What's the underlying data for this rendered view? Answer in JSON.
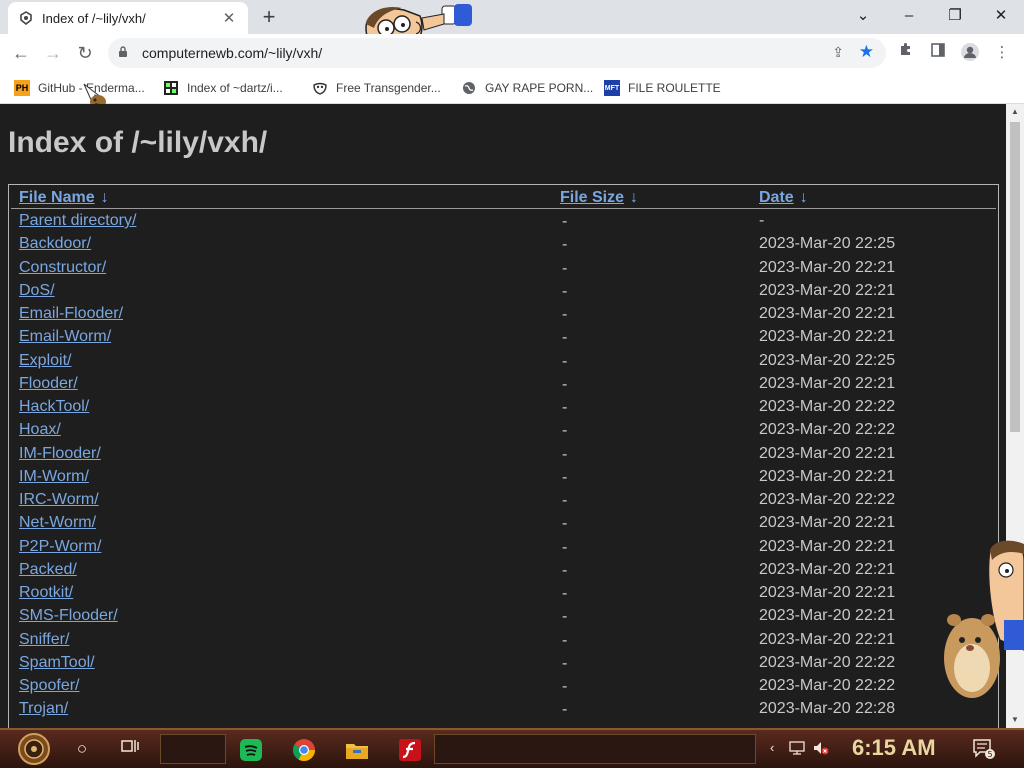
{
  "browser": {
    "tab": {
      "title": "Index of /~lily/vxh/",
      "favicon": "site-icon"
    },
    "new_tab_label": "+",
    "window_controls": {
      "tabsearch": "⌄",
      "minimize": "–",
      "restore": "❐",
      "close": "✕"
    },
    "url": "computernewb.com/~lily/vxh/",
    "bookmarks": [
      {
        "label": "GitHub - Enderma...",
        "icon": "PH"
      },
      {
        "label": "Index of ~dartz/i...",
        "icon": "grid-icon"
      },
      {
        "label": "Free Transgender...",
        "icon": "mask-icon"
      },
      {
        "label": "GAY RAPE PORN...",
        "icon": "globe-icon"
      },
      {
        "label": "FILE ROULETTE",
        "icon": "MFT"
      }
    ]
  },
  "page": {
    "heading": "Index of /~lily/vxh/",
    "columns": {
      "name": "File Name",
      "size": "File Size",
      "date": "Date",
      "sort_arrow": "↓"
    },
    "rows": [
      {
        "name": "Parent directory/",
        "size": "-",
        "date": "-"
      },
      {
        "name": "Backdoor/",
        "size": "-",
        "date": "2023-Mar-20 22:25"
      },
      {
        "name": "Constructor/",
        "size": "-",
        "date": "2023-Mar-20 22:21"
      },
      {
        "name": "DoS/",
        "size": "-",
        "date": "2023-Mar-20 22:21"
      },
      {
        "name": "Email-Flooder/",
        "size": "-",
        "date": "2023-Mar-20 22:21"
      },
      {
        "name": "Email-Worm/",
        "size": "-",
        "date": "2023-Mar-20 22:21"
      },
      {
        "name": "Exploit/",
        "size": "-",
        "date": "2023-Mar-20 22:25"
      },
      {
        "name": "Flooder/",
        "size": "-",
        "date": "2023-Mar-20 22:21"
      },
      {
        "name": "HackTool/",
        "size": "-",
        "date": "2023-Mar-20 22:22"
      },
      {
        "name": "Hoax/",
        "size": "-",
        "date": "2023-Mar-20 22:22"
      },
      {
        "name": "IM-Flooder/",
        "size": "-",
        "date": "2023-Mar-20 22:21"
      },
      {
        "name": "IM-Worm/",
        "size": "-",
        "date": "2023-Mar-20 22:21"
      },
      {
        "name": "IRC-Worm/",
        "size": "-",
        "date": "2023-Mar-20 22:22"
      },
      {
        "name": "Net-Worm/",
        "size": "-",
        "date": "2023-Mar-20 22:21"
      },
      {
        "name": "P2P-Worm/",
        "size": "-",
        "date": "2023-Mar-20 22:21"
      },
      {
        "name": "Packed/",
        "size": "-",
        "date": "2023-Mar-20 22:21"
      },
      {
        "name": "Rootkit/",
        "size": "-",
        "date": "2023-Mar-20 22:21"
      },
      {
        "name": "SMS-Flooder/",
        "size": "-",
        "date": "2023-Mar-20 22:21"
      },
      {
        "name": "Sniffer/",
        "size": "-",
        "date": "2023-Mar-20 22:21"
      },
      {
        "name": "SpamTool/",
        "size": "-",
        "date": "2023-Mar-20 22:22"
      },
      {
        "name": "Spoofer/",
        "size": "-",
        "date": "2023-Mar-20 22:22"
      },
      {
        "name": "Trojan/",
        "size": "-",
        "date": "2023-Mar-20 22:28"
      }
    ]
  },
  "taskbar": {
    "clock": "6:15 AM",
    "notification_count": "5",
    "apps": [
      "spotify-icon",
      "chrome-icon",
      "file-explorer-icon",
      "flash-icon"
    ]
  },
  "colors": {
    "page_bg": "#1e1e1e",
    "link": "#7aa7e0",
    "text": "#c8c8c8",
    "accent": "#1a73e8"
  }
}
